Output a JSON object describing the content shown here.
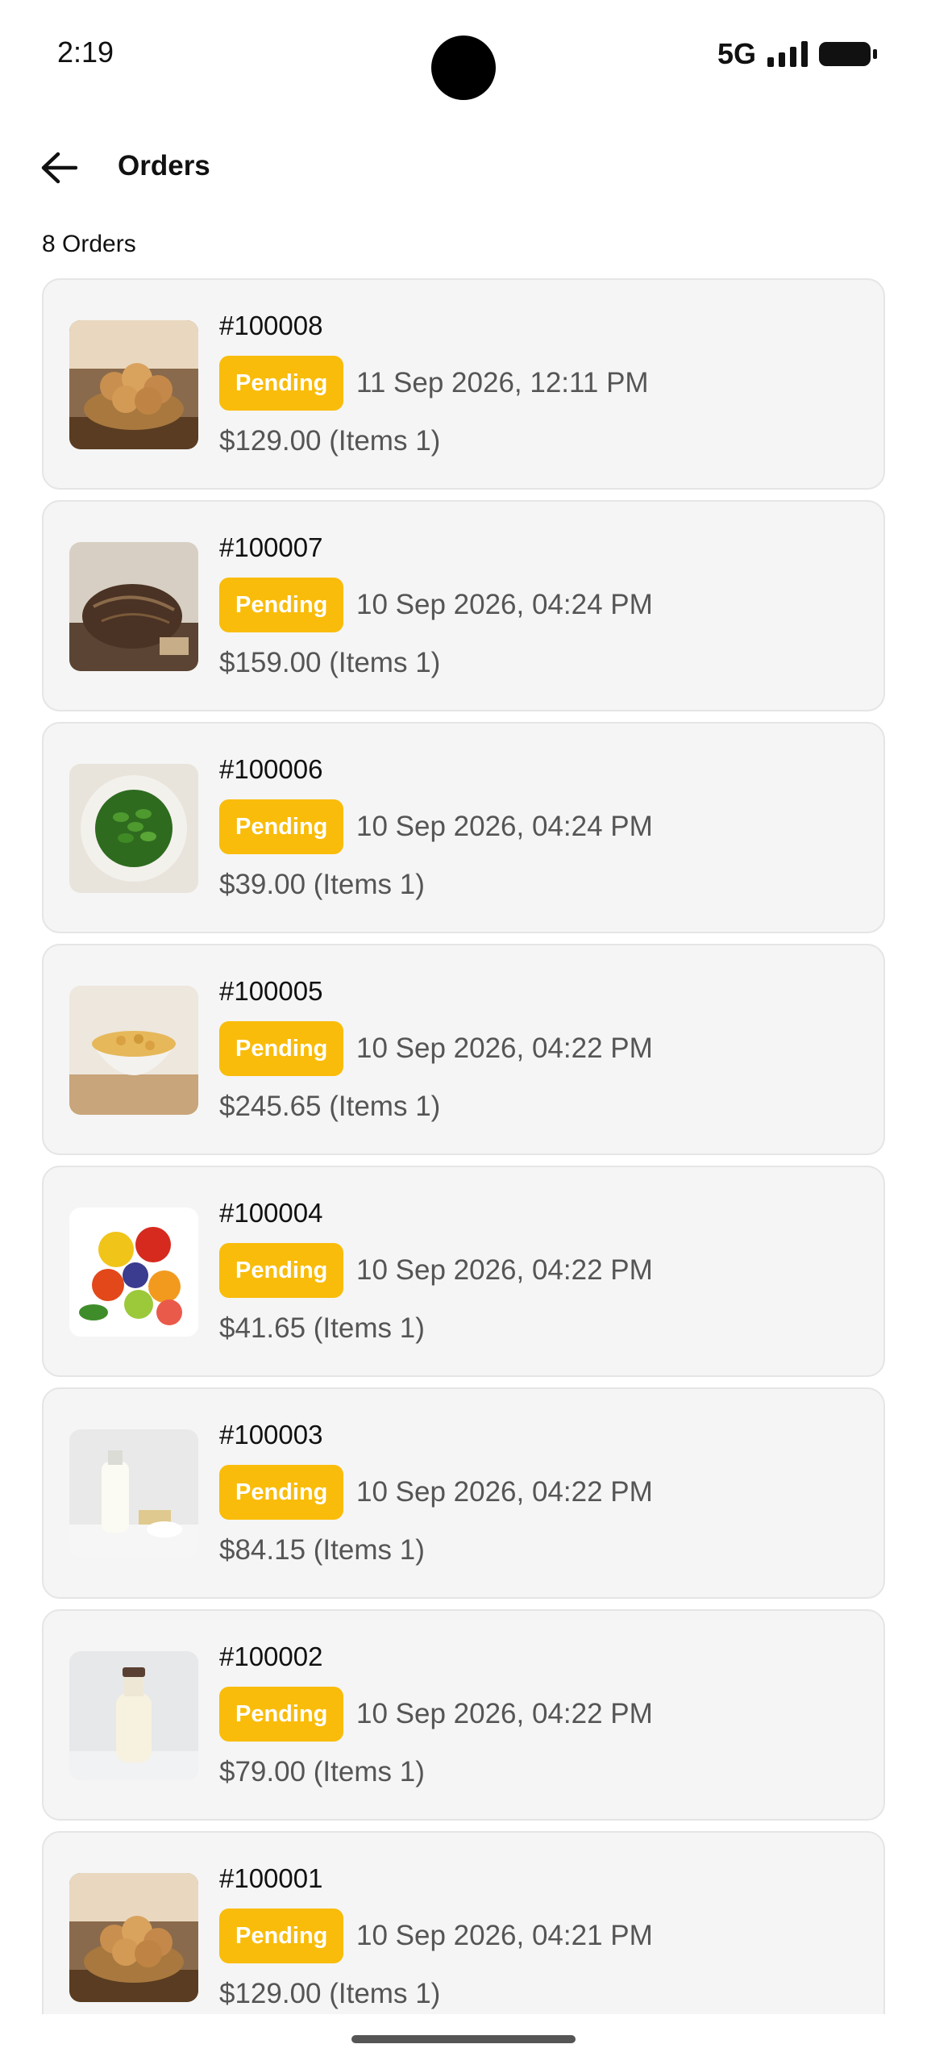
{
  "status_bar": {
    "time": "2:19",
    "network": "5G"
  },
  "header": {
    "title": "Orders",
    "back_icon": "arrow-left-icon"
  },
  "order_count": "8 Orders",
  "colors": {
    "badge": "#f9bc0a",
    "card_bg": "#f5f5f5"
  },
  "orders": [
    {
      "id": "#100008",
      "status": "Pending",
      "date": "11 Sep 2026, 12:11 PM",
      "price": "$129.00 (Items 1)",
      "image": "bread-basket"
    },
    {
      "id": "#100007",
      "status": "Pending",
      "date": "10 Sep 2026, 04:24 PM",
      "price": "$159.00 (Items 1)",
      "image": "sourdough-loaf"
    },
    {
      "id": "#100006",
      "status": "Pending",
      "date": "10 Sep 2026, 04:24 PM",
      "price": "$39.00 (Items 1)",
      "image": "green-beans-plate"
    },
    {
      "id": "#100005",
      "status": "Pending",
      "date": "10 Sep 2026, 04:22 PM",
      "price": "$245.65 (Items 1)",
      "image": "chickpeas-bowl"
    },
    {
      "id": "#100004",
      "status": "Pending",
      "date": "10 Sep 2026, 04:22 PM",
      "price": "$41.65 (Items 1)",
      "image": "fruits-vegetables"
    },
    {
      "id": "#100003",
      "status": "Pending",
      "date": "10 Sep 2026, 04:22 PM",
      "price": "$84.15 (Items 1)",
      "image": "dairy-products"
    },
    {
      "id": "#100002",
      "status": "Pending",
      "date": "10 Sep 2026, 04:22 PM",
      "price": "$79.00 (Items 1)",
      "image": "milk-bottle"
    },
    {
      "id": "#100001",
      "status": "Pending",
      "date": "10 Sep 2026, 04:21 PM",
      "price": "$129.00 (Items 1)",
      "image": "bread-basket"
    }
  ]
}
